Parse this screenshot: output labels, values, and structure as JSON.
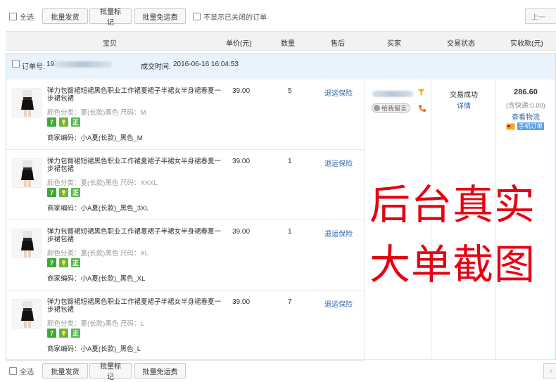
{
  "toolbar": {
    "select_all": "全选",
    "batch_ship": "批量发货",
    "batch_mark": "批量标记",
    "batch_free_ship": "批量免运费",
    "hide_closed": "不显示已关闭的订单",
    "prev_page": "上一"
  },
  "columns": {
    "item": "宝贝",
    "unit_price": "单价(元)",
    "quantity": "数量",
    "after_sale": "售后",
    "buyer": "买家",
    "status": "交易状态",
    "received": "实收款(元)"
  },
  "order": {
    "order_no_label": "订单号:",
    "order_no_visible": "19",
    "time_label": "成交时间:",
    "time": "2016-06-16 16:04:53",
    "buyer": {
      "leave_msg": "给我留言"
    },
    "status": {
      "text": "交易成功",
      "detail_link": "详情"
    },
    "amount": {
      "total": "286.60",
      "shipping": "(含快递:0.00)",
      "view_logistics": "查看物流",
      "mobile_order": "手机订单"
    },
    "items": [
      {
        "title": "弹力包臀裙短裙黑色职业工作裙夏裙子半裙女半身裙春夏一步裙包裙",
        "attr": "颜色分类：夏(长款)黑色  尺码：M",
        "code": "商家编码：小A夏(长款)_黑色_M",
        "price": "39.00",
        "qty": "5",
        "after_sale": "退运保险"
      },
      {
        "title": "弹力包臀裙短裙黑色职业工作裙夏裙子半裙女半身裙春夏一步裙包裙",
        "attr": "颜色分类：夏(长款)黑色  尺码：XXXL",
        "code": "商家编码：小A夏(长款)_黑色_3XL",
        "price": "39.00",
        "qty": "1",
        "after_sale": "退运保险"
      },
      {
        "title": "弹力包臀裙短裙黑色职业工作裙夏裙子半裙女半身裙春夏一步裙包裙",
        "attr": "颜色分类：夏(长款)黑色  尺码：XL",
        "code": "商家编码：小A夏(长款)_黑色_XL",
        "price": "39.00",
        "qty": "1",
        "after_sale": "退运保险"
      },
      {
        "title": "弹力包臀裙短裙黑色职业工作裙夏裙子半裙女半身裙春夏一步裙包裙",
        "attr": "颜色分类：夏(长款)黑色  尺码：L",
        "code": "商家编码：小A夏(长款)_黑色_L",
        "price": "39.00",
        "qty": "7",
        "after_sale": "退运保险"
      }
    ]
  },
  "badges": {
    "seven_day": "7",
    "genuine": "正"
  },
  "overlay": {
    "line1": "后台真实",
    "line2": "大单截图"
  },
  "colors": {
    "watermark": "#e60012",
    "link": "#3366aa",
    "badge_green": "#3ea836",
    "order_header_bg": "#eaf3fb"
  },
  "icons": {
    "filter": "funnel-icon",
    "phone": "phone-icon",
    "mobile": "mobile-order-icon"
  }
}
